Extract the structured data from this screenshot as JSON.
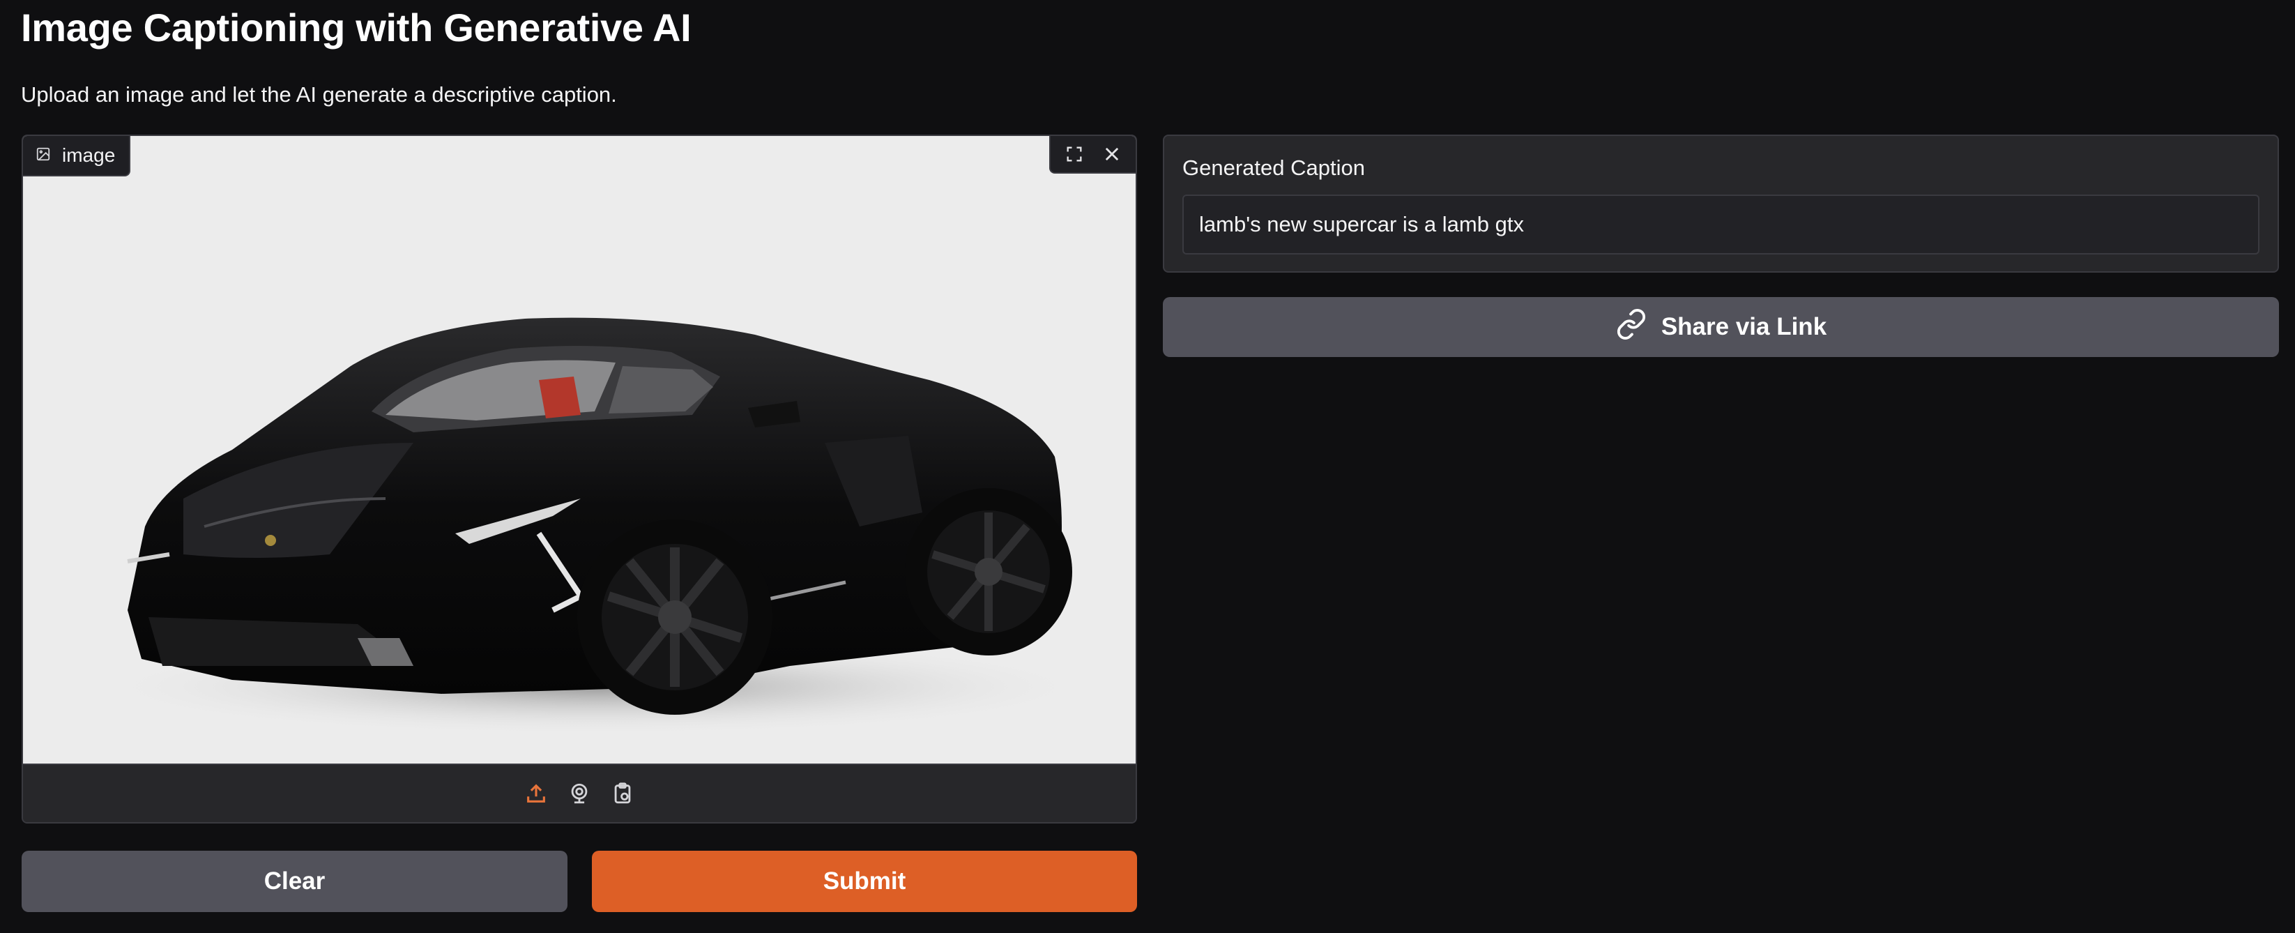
{
  "page": {
    "title": "Image Captioning with Generative AI",
    "subtitle": "Upload an image and let the AI generate a descriptive caption."
  },
  "image_input": {
    "label": "image",
    "label_icon": "image-icon",
    "controls": [
      "fullscreen-icon",
      "close-icon"
    ],
    "sources": [
      "upload-icon",
      "webcam-icon",
      "clipboard-icon"
    ],
    "active_source_color": "#e8743b"
  },
  "buttons": {
    "clear_label": "Clear",
    "submit_label": "Submit",
    "share_label": "Share via Link",
    "share_icon": "link-icon"
  },
  "output": {
    "label": "Generated Caption",
    "value": "lamb's new supercar is a lamb gtx"
  },
  "colors": {
    "background": "#0f0f11",
    "panel": "#27272a",
    "accent": "#dd5f26",
    "secondary_button": "#52525b"
  }
}
